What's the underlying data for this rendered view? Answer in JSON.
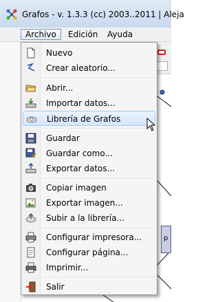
{
  "window": {
    "title": "Grafos - v. 1.3.3  (cc) 2003..2011  |  Aleja"
  },
  "menubar": {
    "items": [
      {
        "label": "Archivo"
      },
      {
        "label": "Edición"
      },
      {
        "label": "Ayuda"
      }
    ]
  },
  "menu": {
    "items": [
      {
        "label": "Nuevo",
        "icon": "new-document-icon"
      },
      {
        "label": "Crear aleatorio...",
        "icon": "random-graph-icon"
      },
      {
        "label": "Abrir...",
        "icon": "open-folder-icon"
      },
      {
        "label": "Importar datos...",
        "icon": "import-icon"
      },
      {
        "label": "Librería de Grafos",
        "icon": "library-icon",
        "highlighted": true
      },
      {
        "label": "Guardar",
        "icon": "save-icon"
      },
      {
        "label": "Guardar como...",
        "icon": "save-as-icon"
      },
      {
        "label": "Exportar datos...",
        "icon": "export-icon"
      },
      {
        "label": "Copiar imagen",
        "icon": "camera-icon"
      },
      {
        "label": "Exportar imagen...",
        "icon": "export-image-icon"
      },
      {
        "label": "Subir a la librería...",
        "icon": "upload-icon"
      },
      {
        "label": "Configurar impresora...",
        "icon": "printer-setup-icon"
      },
      {
        "label": "Configurar página...",
        "icon": "page-setup-icon"
      },
      {
        "label": "Imprimir...",
        "icon": "print-icon"
      },
      {
        "label": "Salir",
        "icon": "exit-icon"
      }
    ]
  },
  "canvas": {
    "node_label": "p"
  },
  "colors": {
    "highlight": "#d4e6fb",
    "menu_bg": "#f5f5f5",
    "node_fill": "#c8cde6"
  }
}
